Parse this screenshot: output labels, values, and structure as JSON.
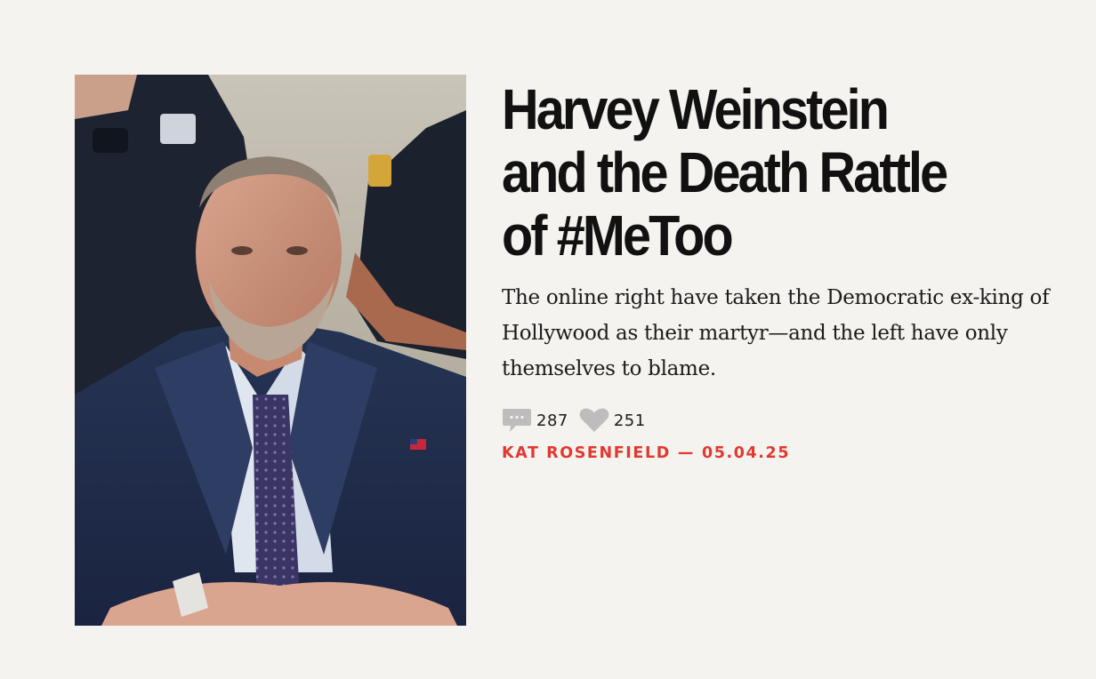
{
  "article": {
    "headline": "Harvey Weinstein and the Death Rattle of #MeToo",
    "standfirst": "The online right have taken the Democratic ex-king of Hollywood as their martyr—and the left have only themselves to blame.",
    "comments_count": "287",
    "likes_count": "251",
    "author": "KAT ROSENFIELD",
    "separator": "—",
    "date": "05.04.25",
    "accent_color": "#e2382f",
    "comment_icon": "comment-bubble-icon",
    "like_icon": "heart-icon"
  }
}
